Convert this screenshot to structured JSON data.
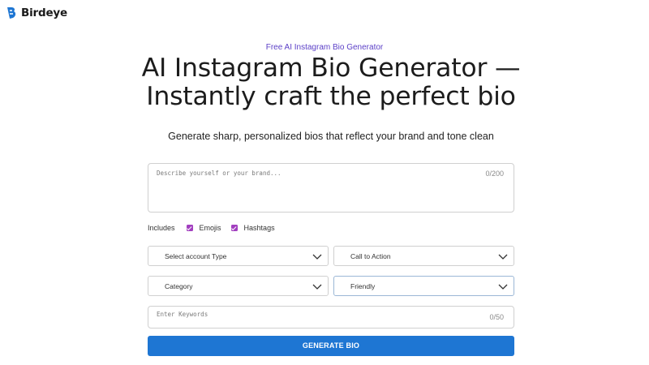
{
  "brand": {
    "name": "Birdeye"
  },
  "hero": {
    "eyebrow": "Free AI Instagram Bio Generator",
    "title_line1": "AI Instagram Bio Generator —",
    "title_line2": "Instantly craft the perfect bio",
    "subtitle": "Generate sharp, personalized bios that reflect your brand and tone clean"
  },
  "form": {
    "bio": {
      "placeholder": "Describe yourself or your brand...",
      "counter": "0/200"
    },
    "includes": {
      "label": "Includes",
      "options": [
        {
          "label": "Emojis",
          "checked": true
        },
        {
          "label": "Hashtags",
          "checked": true
        }
      ]
    },
    "selects": {
      "account_type": "Select account Type",
      "call_to_action": "Call to Action",
      "category": "Category",
      "tone": "Friendly"
    },
    "keywords": {
      "placeholder": "Enter Keywords",
      "counter": "0/50"
    },
    "generate_label": "GENERATE BIO"
  },
  "colors": {
    "accent": "#1e76d3",
    "eyebrow": "#5b3fc7",
    "checkbox": "#a23fbf"
  }
}
